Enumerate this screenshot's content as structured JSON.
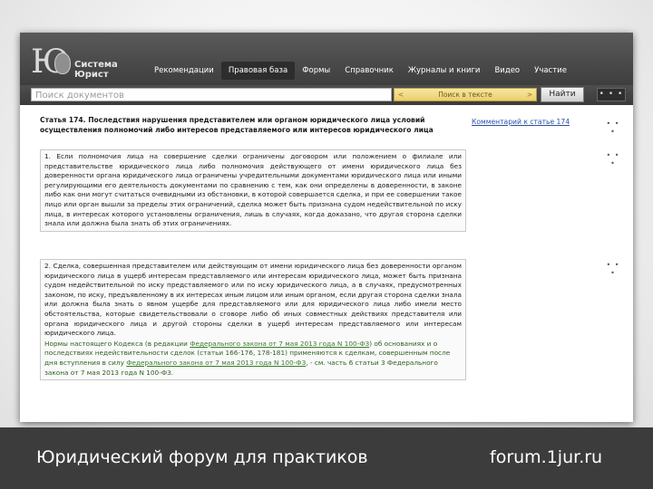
{
  "header": {
    "logo_mark": "Ю",
    "logo_line1": "Система",
    "logo_line2": "Юрист",
    "nav": [
      "Рекомендации",
      "Правовая база",
      "Формы",
      "Справочник",
      "Журналы и книги",
      "Видео",
      "Участие"
    ],
    "active_nav": "Правовая база"
  },
  "search": {
    "placeholder": "Поиск документов",
    "prev_arrow": "<",
    "next_arrow": ">",
    "text_search_label": "Поиск в тексте",
    "find_label": "Найти",
    "more_label": "• • •"
  },
  "article": {
    "title": "Статья 174. Последствия нарушения представителем или органом юридического лица условий осуществления полномочий либо интересов представляемого или интересов юридического лица",
    "comment_link": "Комментарий к статье 174",
    "more_label": "• • •",
    "p1": "1. Если полномочия лица на совершение сделки ограничены договором или положением о филиале или представительстве юридического лица либо полномочия действующего от имени юридического лица без доверенности органа юридического лица ограничены учредительными документами юридического лица или иными регулирующими его деятельность документами по сравнению с тем, как они определены в доверенности, в законе либо как они могут считаться очевидными из обстановки, в которой совершается сделка, и при ее совершении такое лицо или орган вышли за пределы этих ограничений, сделка может быть признана судом недействительной по иску лица, в интересах которого установлены ограничения, лишь в случаях, когда доказано, что другая сторона сделки знала или должна была знать об этих ограничениях.",
    "p2": "2. Сделка, совершенная представителем или действующим от имени юридического лица без доверенности органом юридического лица в ущерб интересам представляемого или интересам юридического лица, может быть признана судом недействительной по иску представляемого или по иску юридического лица, а в случаях, предусмотренных законом, по иску, предъявленному в их интересах иным лицом или иным органом, если другая сторона сделки знала или должна была знать о явном ущербе для представляемого или для юридического лица либо имели место обстоятельства, которые свидетельствовали о сговоре либо об иных совместных действиях представителя или органа юридического лица и другой стороны сделки в ущерб интересам представляемого или интересам юридического лица.",
    "note_start": "Нормы настоящего Кодекса (в редакции ",
    "note_link1": "Федерального закона от 7 мая 2013 года N 100-ФЗ",
    "note_mid": ") об основаниях и о последствиях недействительности сделок (статьи 166-176, 178-181) применяются к сделкам, совершенным после дня вступления в силу ",
    "note_link2": "Федерального закона от 7 мая 2013 года N 100-ФЗ",
    "note_end": ", - см. часть 6 статьи 3 Федерального закона от 7 мая 2013 года N 100-ФЗ."
  },
  "footer": {
    "left": "Юридический форум для практиков",
    "right": "forum.1jur.ru"
  }
}
